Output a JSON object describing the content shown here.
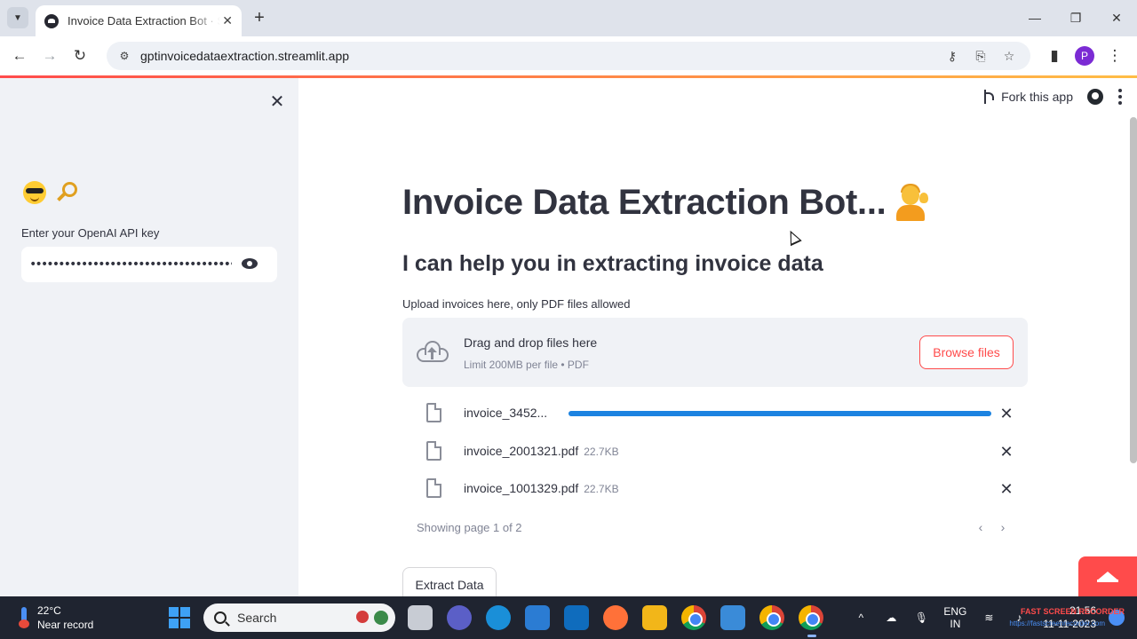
{
  "browser": {
    "tab_title": "Invoice Data Extraction Bot · Streamlit",
    "url": "gptinvoicedataextraction.streamlit.app",
    "profile_initial": "P"
  },
  "header": {
    "fork_label": "Fork this app"
  },
  "sidebar": {
    "api_key_label": "Enter your OpenAI API key",
    "api_key_value": "••••••••••••••••••••••••••••••••••••••••••••••••"
  },
  "main": {
    "title": "Invoice Data Extraction Bot...",
    "subtitle": "I can help you in extracting invoice data",
    "upload_label": "Upload invoices here, only PDF files allowed",
    "dropzone_title": "Drag and drop files here",
    "dropzone_limit": "Limit 200MB per file • PDF",
    "browse_label": "Browse files",
    "files": [
      {
        "name": "invoice_3452...",
        "size": "",
        "progress": 1.0,
        "uploading": true
      },
      {
        "name": "invoice_2001321.pdf",
        "size": "22.7KB",
        "uploading": false
      },
      {
        "name": "invoice_1001329.pdf",
        "size": "22.7KB",
        "uploading": false
      }
    ],
    "pager_text": "Showing page 1 of 2",
    "extract_label": "Extract Data"
  },
  "taskbar": {
    "temperature": "22°C",
    "weather_text": "Near record",
    "search_placeholder": "Search",
    "lang_top": "ENG",
    "lang_bottom": "IN",
    "time": "21:56",
    "date": "11-11-2023",
    "watermark": "FAST SCREEN RECORDER",
    "watermark_url": "https://fastscreenrecorder.com"
  },
  "colors": {
    "primary": "#ff4b4b",
    "progress": "#1c83e1",
    "sidebar_bg": "#f0f2f6",
    "text": "#31333f"
  }
}
